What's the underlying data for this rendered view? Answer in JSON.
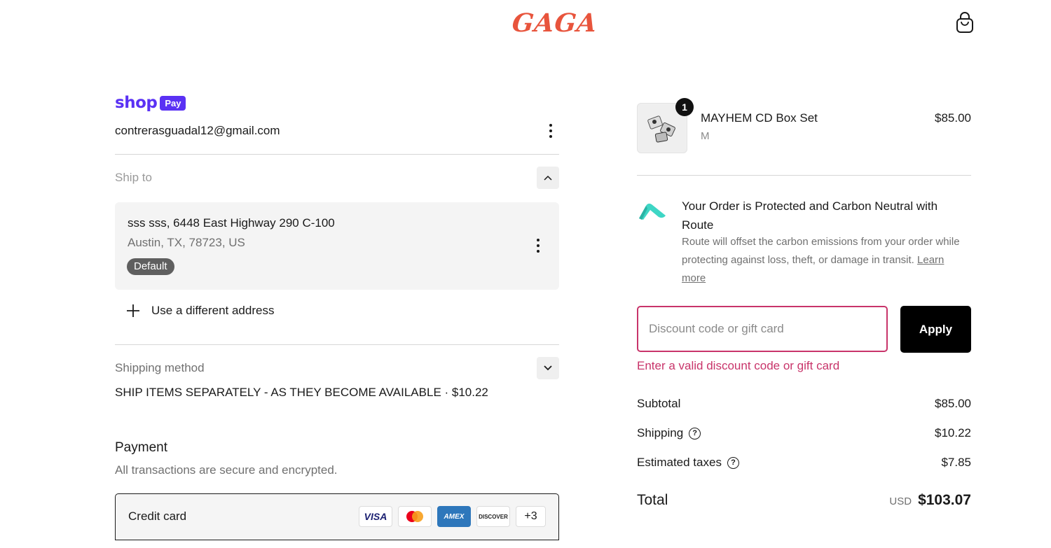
{
  "header": {
    "logo_text": "GAGA",
    "cart_icon": "shopping-bag-icon"
  },
  "express": {
    "shop_word": "shop",
    "pay_badge": "Pay"
  },
  "account": {
    "email": "contrerasguadal12@gmail.com"
  },
  "ship_to": {
    "label": "Ship to",
    "address_line1": "sss sss, 6448 East Highway 290 C-100",
    "address_line2": "Austin, TX, 78723, US",
    "default_badge": "Default",
    "use_different": "Use a different address"
  },
  "shipping_method": {
    "label": "Shipping method",
    "value": "SHIP ITEMS SEPARATELY - AS THEY BECOME AVAILABLE · $10.22"
  },
  "payment": {
    "title": "Payment",
    "subtitle": "All transactions are secure and encrypted.",
    "method_label": "Credit card",
    "cards": [
      "VISA",
      "Mastercard",
      "AMEX",
      "DISCOVER"
    ],
    "more_cards": "+3"
  },
  "cart": {
    "item": {
      "quantity": "1",
      "name": "MAYHEM CD Box Set",
      "variant": "M",
      "price": "$85.00"
    }
  },
  "route": {
    "title": "Your Order is Protected and Carbon Neutral with Route",
    "description": "Route will offset the carbon emissions from your order while protecting against loss, theft, or damage in transit.",
    "link": "Learn more"
  },
  "discount": {
    "placeholder": "Discount code or gift card",
    "apply_label": "Apply",
    "error": "Enter a valid discount code or gift card"
  },
  "summary": {
    "subtotal_label": "Subtotal",
    "subtotal_value": "$85.00",
    "shipping_label": "Shipping",
    "shipping_value": "$10.22",
    "taxes_label": "Estimated taxes",
    "taxes_value": "$7.85",
    "total_label": "Total",
    "currency": "USD",
    "total_value": "$103.07"
  },
  "colors": {
    "brand_logo": "#e8543c",
    "shop_pay": "#5a31f4",
    "error": "#c8346a",
    "route_teal": "#3ed6c5"
  }
}
